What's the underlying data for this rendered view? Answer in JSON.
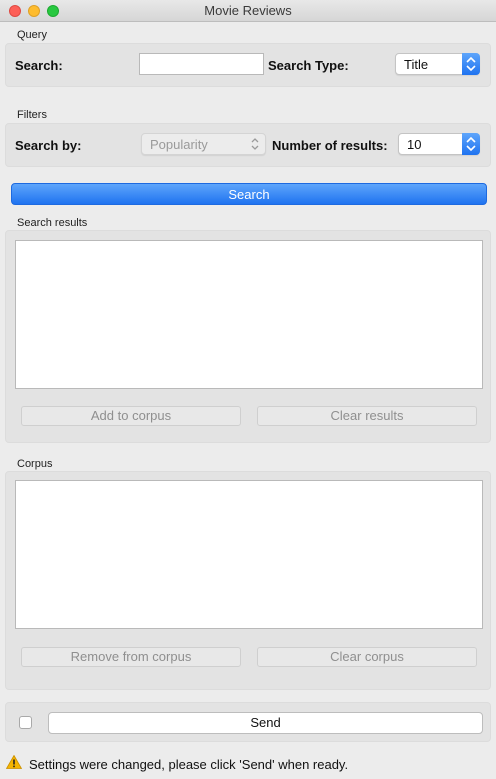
{
  "window": {
    "title": "Movie Reviews"
  },
  "query": {
    "group_title": "Query",
    "search_label": "Search:",
    "search_value": "",
    "search_type_label": "Search Type:",
    "search_type_value": "Title"
  },
  "filters": {
    "group_title": "Filters",
    "search_by_label": "Search by:",
    "search_by_value": "Popularity",
    "num_results_label": "Number of results:",
    "num_results_value": "10"
  },
  "search_button": "Search",
  "results": {
    "group_title": "Search results",
    "add_button": "Add to corpus",
    "clear_button": "Clear results"
  },
  "corpus": {
    "group_title": "Corpus",
    "remove_button": "Remove from corpus",
    "clear_button": "Clear corpus"
  },
  "send": {
    "button": "Send",
    "auto_send_checked": false
  },
  "status": {
    "message": "Settings were changed, please click 'Send' when ready."
  },
  "colors": {
    "accent": "#1f73f0",
    "warning": "#f5b400"
  }
}
